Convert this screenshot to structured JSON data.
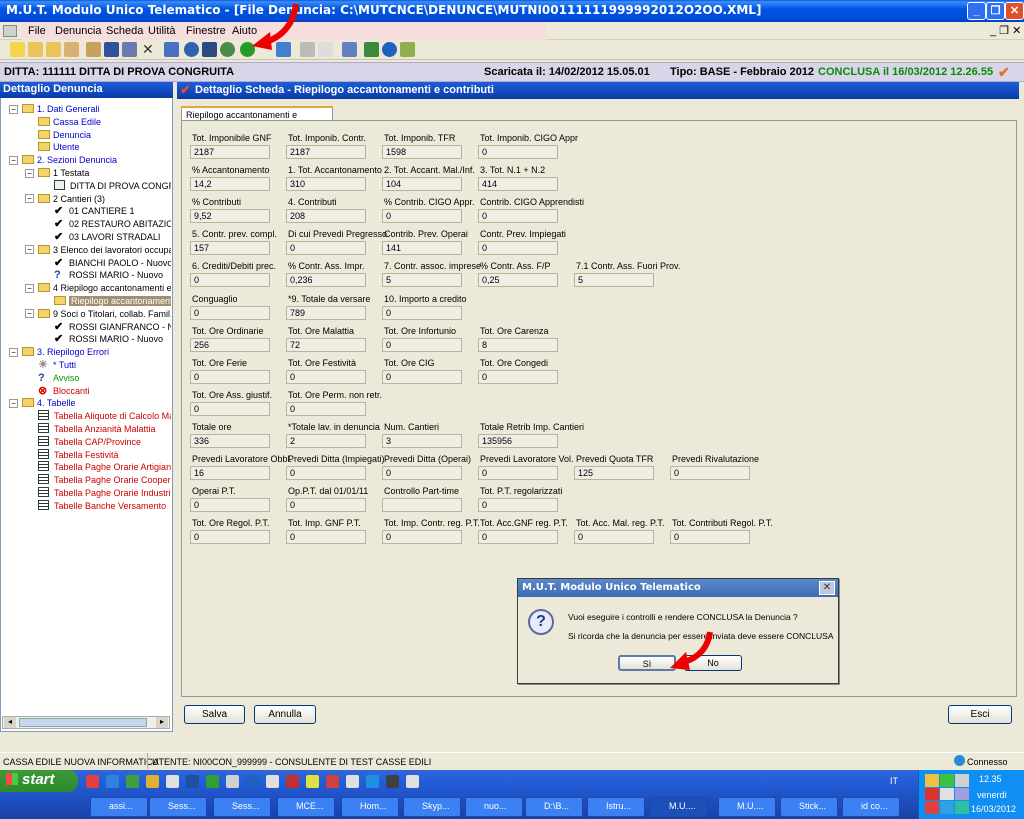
{
  "window": {
    "title": "M.U.T. Modulo Unico Telematico - [File Denuncia: C:\\MUTCNCE\\DENUNCE\\MUTNI00111111999992012O2OO.XML]"
  },
  "menu": [
    "File",
    "Denuncia",
    "Scheda",
    "Utilità",
    "Finestre",
    "Aiuto"
  ],
  "info": {
    "ditta": "DITTA: 111111 DITTA DI PROVA CONGRUITA",
    "scaricata": "Scaricata il: 14/02/2012 15.05.01",
    "tipo": "Tipo: BASE - Febbraio 2012",
    "conclusa": "CONCLUSA il 16/03/2012 12.26.55"
  },
  "left": {
    "header": "Dettaglio Denuncia",
    "tree": [
      {
        "t": "1. Dati Generali",
        "c": "#00c",
        "k": "folder"
      },
      {
        "t": "Cassa Edile",
        "c": "#00c",
        "k": "folder"
      },
      {
        "t": "Denuncia",
        "c": "#00c",
        "k": "folder"
      },
      {
        "t": "Utente",
        "c": "#00c",
        "k": "folder"
      },
      {
        "t": "2. Sezioni Denuncia",
        "c": "#00c",
        "k": "folder"
      },
      {
        "t": "1 Testata",
        "c": "#000",
        "k": "folder"
      },
      {
        "t": "DITTA DI PROVA CONGR",
        "c": "#000",
        "k": "card"
      },
      {
        "t": "2 Cantieri (3)",
        "c": "#000",
        "k": "folder"
      },
      {
        "t": "01 CANTIERE 1",
        "c": "#000",
        "k": "check"
      },
      {
        "t": "02 RESTAURO ABITAZIO",
        "c": "#000",
        "k": "check"
      },
      {
        "t": "03 LAVORI STRADALI",
        "c": "#000",
        "k": "check"
      },
      {
        "t": "3 Elenco dei lavoratori occupat",
        "c": "#000",
        "k": "folder"
      },
      {
        "t": "BIANCHI PAOLO - Nuovo",
        "c": "#000",
        "k": "check"
      },
      {
        "t": "ROSSI MARIO - Nuovo",
        "c": "#000",
        "k": "q"
      },
      {
        "t": "4 Riepilogo accantonamenti e",
        "c": "#000",
        "k": "folder"
      },
      {
        "t": "Riepilogo accantonamenti",
        "c": "#fff",
        "k": "folder"
      },
      {
        "t": "9 Soci o Titolari, collab. Famil. (",
        "c": "#000",
        "k": "folder"
      },
      {
        "t": "ROSSI GIANFRANCO - N",
        "c": "#000",
        "k": "check"
      },
      {
        "t": "ROSSI MARIO - Nuovo",
        "c": "#000",
        "k": "check"
      },
      {
        "t": "3. Riepilogo Errori",
        "c": "#00c",
        "k": "folder"
      },
      {
        "t": "* Tutti",
        "c": "#00c",
        "k": "bulb"
      },
      {
        "t": "Avviso",
        "c": "#090",
        "k": "q"
      },
      {
        "t": "Bloccanti",
        "c": "#c00",
        "k": "x"
      },
      {
        "t": "4. Tabelle",
        "c": "#00c",
        "k": "folder"
      },
      {
        "t": "Tabella Aliquote di Calcolo Mal",
        "c": "#c00",
        "k": "tbl"
      },
      {
        "t": "Tabella Anzianità Malattia",
        "c": "#c00",
        "k": "tbl"
      },
      {
        "t": "Tabella CAP/Province",
        "c": "#c00",
        "k": "tbl"
      },
      {
        "t": "Tabella Festività",
        "c": "#c00",
        "k": "tbl"
      },
      {
        "t": "Tabella Paghe Orarie Artigiani",
        "c": "#c00",
        "k": "tbl"
      },
      {
        "t": "Tabella Paghe Orarie Cooperat",
        "c": "#c00",
        "k": "tbl"
      },
      {
        "t": "Tabella Paghe Orarie Industria",
        "c": "#c00",
        "k": "tbl"
      },
      {
        "t": "Tabelle Banche Versamento",
        "c": "#c00",
        "k": "tbl"
      }
    ]
  },
  "right": {
    "header": "Dettaglio Scheda - Riepilogo accantonamenti e contributi",
    "tab": "Riepilogo accantonamenti e contributi"
  },
  "fields": [
    [
      [
        "Tot. Imponibile GNF",
        "2187"
      ],
      [
        "Tot. Imponib. Contr.",
        "2187"
      ],
      [
        "Tot. Imponib. TFR",
        "1598"
      ],
      [
        "Tot. Imponib. CIGO Appr",
        "0"
      ]
    ],
    [
      [
        "% Accantonamento",
        "14,2"
      ],
      [
        "1. Tot. Accantonamento",
        "310"
      ],
      [
        "2. Tot. Accant. Mal./Inf.",
        "104"
      ],
      [
        "3. Tot. N.1 + N.2",
        "414"
      ]
    ],
    [
      [
        "% Contributi",
        "9,52"
      ],
      [
        "4. Contributi",
        "208"
      ],
      [
        "% Contrib. CIGO Appr.",
        "0"
      ],
      [
        "Contrib. CIGO Apprendisti",
        "0"
      ]
    ],
    [
      [
        "5. Contr. prev. compl.",
        "157"
      ],
      [
        "Di cui Prevedi Pregresso",
        "0"
      ],
      [
        "Contrib. Prev. Operai",
        "141"
      ],
      [
        "Contr. Prev. Impiegati",
        "0"
      ]
    ],
    [
      [
        "6. Crediti/Debiti prec.",
        "0"
      ],
      [
        "% Contr. Ass. Impr.",
        "0,236"
      ],
      [
        "7. Contr. assoc. imprese",
        "5"
      ],
      [
        "% Contr. Ass. F/P",
        "0,25"
      ],
      [
        "7.1 Contr. Ass. Fuori Prov.",
        "5"
      ]
    ],
    [
      [
        "Conguaglio",
        "0"
      ],
      [
        "*9. Totale da versare",
        "789"
      ],
      [
        "10. Importo a credito",
        "0"
      ]
    ],
    [
      [
        "Tot. Ore Ordinarie",
        "256"
      ],
      [
        "Tot. Ore Malattia",
        "72"
      ],
      [
        "Tot. Ore Infortunio",
        "0"
      ],
      [
        "Tot. Ore Carenza",
        "8"
      ]
    ],
    [
      [
        "Tot. Ore Ferie",
        "0"
      ],
      [
        "Tot. Ore Festività",
        "0"
      ],
      [
        "Tot. Ore CIG",
        "0"
      ],
      [
        "Tot. Ore Congedi",
        "0"
      ]
    ],
    [
      [
        "Tot. Ore Ass. giustif.",
        "0"
      ],
      [
        "Tot. Ore Perm. non retr.",
        "0"
      ]
    ],
    [
      [
        "Totale ore",
        "336"
      ],
      [
        "*Totale lav. in denuncia",
        "2"
      ],
      [
        "Num. Cantieri",
        "3"
      ],
      [
        "Totale Retrib Imp. Cantieri",
        "135956"
      ]
    ],
    [
      [
        "Prevedi Lavoratore Obbl.",
        "16"
      ],
      [
        "Prevedi Ditta (Impiegati)",
        "0"
      ],
      [
        "Prevedi Ditta (Operai)",
        "0"
      ],
      [
        "Prevedi Lavoratore Vol.",
        "0"
      ],
      [
        "Prevedi Quota TFR",
        "125"
      ],
      [
        "Prevedi Rivalutazione",
        "0"
      ]
    ],
    [
      [
        "Operai P.T.",
        "0"
      ],
      [
        "Op.P.T. dal 01/01/11",
        "0"
      ],
      [
        "Controllo Part-time",
        ""
      ],
      [
        "Tot. P.T. regolarizzati",
        "0"
      ]
    ],
    [
      [
        "Tot. Ore Regol. P.T.",
        "0"
      ],
      [
        "Tot. Imp. GNF P.T.",
        "0"
      ],
      [
        "Tot. Imp. Contr. reg. P.T.",
        "0"
      ],
      [
        "Tot. Acc.GNF reg. P.T.",
        "0"
      ],
      [
        "Tot. Acc. Mal. reg. P.T.",
        "0"
      ],
      [
        "Tot. Contributi Regol. P.T.",
        "0"
      ]
    ]
  ],
  "buttons": {
    "salva": "Salva",
    "annulla": "Annulla",
    "esci": "Esci"
  },
  "dialog": {
    "title": "M.U.T. Modulo Unico Telematico",
    "line1": "Vuoi eseguire i controlli e rendere CONCLUSA la Denuncia ?",
    "line2": "Si ricorda che la denuncia per essere inviata deve essere CONCLUSA",
    "yes": "Sì",
    "no": "No"
  },
  "status": {
    "left": "CASSA EDILE NUOVA INFORMATICA",
    "user": "UTENTE: NI00CON_999999 - CONSULENTE DI TEST CASSE EDILI",
    "conn": "Connesso"
  },
  "taskbar": {
    "start": "start",
    "tasks": [
      "assi...",
      "Sess...",
      "Sess...",
      "MCE...",
      "Hom...",
      "Skyp...",
      "nuo...",
      "D:\\B...",
      "Istru...",
      "M.U....",
      "M.U....",
      "Stick...",
      "id co..."
    ],
    "time": "12.35",
    "day": "venerdì",
    "date": "16/03/2012",
    "tray_letters": "IT"
  }
}
